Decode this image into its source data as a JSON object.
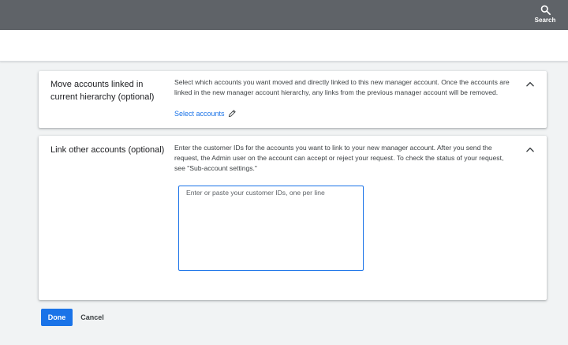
{
  "header": {
    "search_label": "Search",
    "icons": {
      "search": "search-icon"
    }
  },
  "sections": [
    {
      "title": "Move accounts linked in current hierarchy (optional)",
      "description": "Select which accounts you want moved and directly linked to this new manager account. Once the accounts are linked in the new manager account hierarchy, any links from the previous manager account will be removed.",
      "link_label": "Select accounts",
      "icons": {
        "link": "pencil-icon",
        "toggle": "chevron-up-icon"
      }
    },
    {
      "title": "Link other accounts (optional)",
      "description": "Enter the customer IDs for the accounts you want to link to your new manager account. After you send the request, the Admin user on the account can accept or reject your request. To check the status of your request, see \"Sub-account settings.\"",
      "input_placeholder": "Enter or paste your customer IDs, one per line",
      "input_value": "",
      "icons": {
        "toggle": "chevron-up-icon"
      }
    }
  ],
  "actions": {
    "done_label": "Done",
    "cancel_label": "Cancel"
  },
  "colors": {
    "topbar": "#5f6368",
    "accent": "#1a73e8",
    "background": "#f1f3f4"
  }
}
